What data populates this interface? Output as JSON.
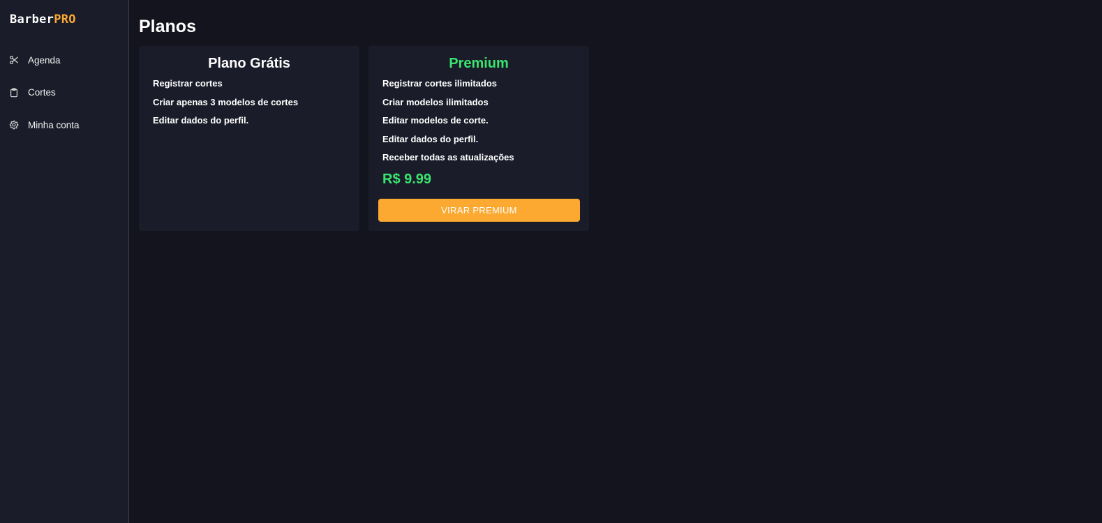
{
  "sidebar": {
    "logo": {
      "part1": "Barber",
      "part2": "PRO"
    },
    "items": [
      {
        "label": "Agenda",
        "icon": "scissors-icon"
      },
      {
        "label": "Cortes",
        "icon": "clipboard-icon"
      },
      {
        "label": "Minha conta",
        "icon": "gear-icon"
      }
    ]
  },
  "main": {
    "title": "Planos",
    "plans": {
      "free": {
        "title": "Plano Grátis",
        "features": [
          "Registrar cortes",
          "Criar apenas 3 modelos de cortes",
          "Editar dados do perfil."
        ]
      },
      "premium": {
        "title": "Premium",
        "features": [
          "Registrar cortes ilimitados",
          "Criar modelos ilimitados",
          "Editar modelos de corte.",
          "Editar dados do perfil.",
          "Receber todas as atualizações"
        ],
        "price": "R$ 9.99",
        "button_label": "VIRAR PREMIUM"
      }
    }
  },
  "colors": {
    "background": "#13141d",
    "panel": "#1a1c29",
    "accent_orange": "#fba931",
    "accent_green": "#39e56f",
    "text": "#ffffff"
  }
}
